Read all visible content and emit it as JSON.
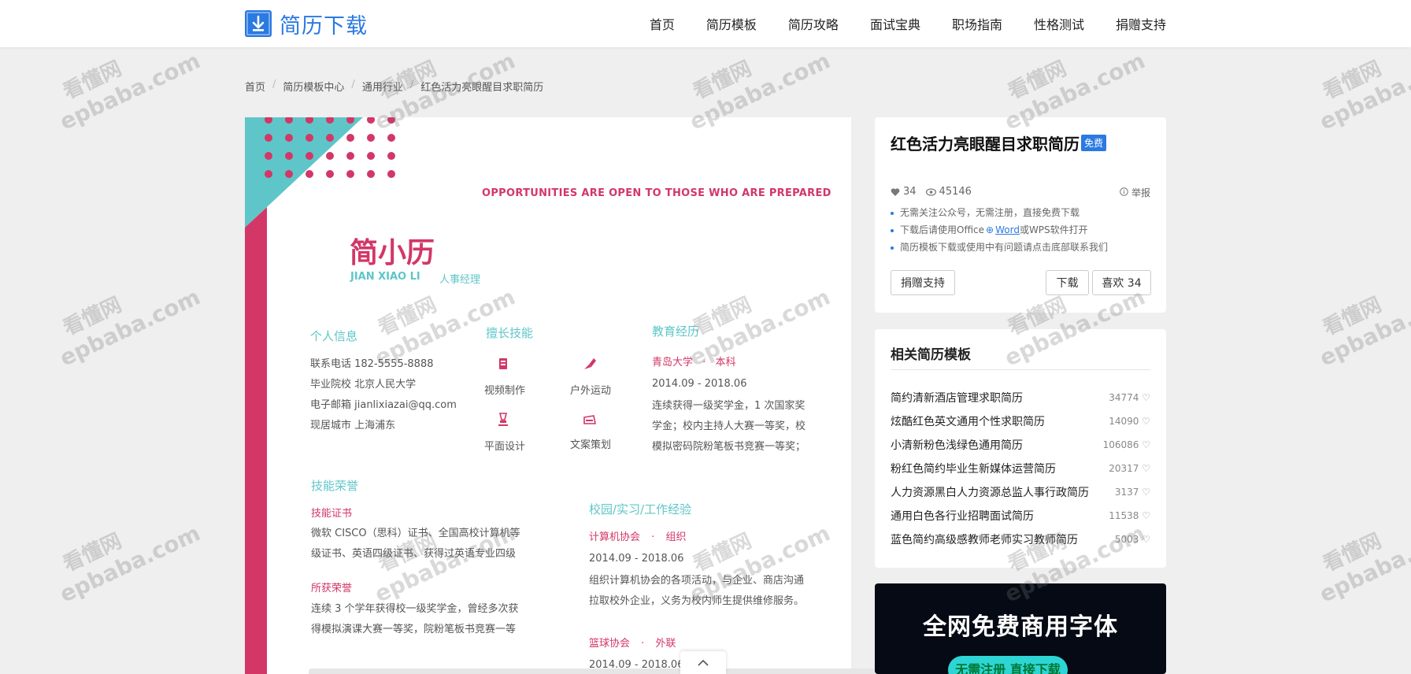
{
  "header": {
    "logo_text": "简历下载",
    "nav": [
      "首页",
      "简历模板",
      "简历攻略",
      "面试宝典",
      "职场指南",
      "性格测试",
      "捐赠支持"
    ]
  },
  "breadcrumb": [
    "首页",
    "简历模板中心",
    "通用行业",
    "红色活力亮眼醒目求职简历"
  ],
  "resume": {
    "slogan": "OPPORTUNITIES ARE OPEN TO THOSE WHO ARE PREPARED",
    "name": "简小历",
    "name_en": "JIAN XIAO LI",
    "position": "人事经理",
    "personal": {
      "title": "个人信息",
      "lines": [
        "联系电话  182-5555-8888",
        "毕业院校  北京人民大学",
        "电子邮箱  jianlixiazai@qq.com",
        "现居城市  上海浦东"
      ]
    },
    "skills": {
      "title": "擅长技能",
      "items": [
        {
          "label": "视频制作",
          "icon": "video-icon"
        },
        {
          "label": "户外运动",
          "icon": "sport-icon"
        },
        {
          "label": "平面设计",
          "icon": "design-icon"
        },
        {
          "label": "文案策划",
          "icon": "copywriting-icon"
        }
      ]
    },
    "education": {
      "title": "教育经历",
      "school": "青岛大学",
      "dot": "·",
      "degree": "本科",
      "period": "2014.09 - 2018.06",
      "lines": [
        "连续获得一级奖学金，1 次国家奖",
        "学金；校内主持人大赛一等奖，校",
        "模拟密码院粉笔板书竞赛一等奖；"
      ]
    },
    "honors": {
      "title": "技能荣誉",
      "cert_title": "技能证书",
      "cert_lines": [
        "微软 CISCO（思科）证书、全国高校计算机等",
        "级证书、英语四级证书、获得过英语专业四级"
      ],
      "award_title": "所获荣誉",
      "award_lines": [
        "连续 3 个学年获得校一级奖学金，曾经多次获",
        "得模拟演课大赛一等奖，院粉笔板书竞赛一等"
      ]
    },
    "experience": {
      "title": "校园/实习/工作经验",
      "org1": "计算机协会",
      "dot": "·",
      "role1": "组织",
      "period1": "2014.09 - 2018.06",
      "lines1": [
        "组织计算机协会的各项活动，与企业、商店沟通",
        "拉取校外企业，义务为校内师生提供维修服务。"
      ],
      "org2": "篮球协会",
      "role2": "外联",
      "period2": "2014.09 - 2018.06"
    }
  },
  "sidebar": {
    "title": "红色活力亮眼醒目求职简历",
    "badge": "免费",
    "likes": "34",
    "views": "45146",
    "report": "举报",
    "tips": [
      {
        "pre": "无需关注公众号，无需注册，直接免费下载",
        "link": "",
        "post": ""
      },
      {
        "pre": "下载后请使用Office",
        "link": "Word",
        "post": "或WPS软件打开"
      },
      {
        "pre": "简历模板下载或使用中有问题请点击底部联系我们",
        "link": "",
        "post": ""
      }
    ],
    "donate_btn": "捐赠支持",
    "download_btn": "下载",
    "like_btn": "喜欢 34"
  },
  "related": {
    "title": "相关简历模板",
    "items": [
      {
        "name": "简约清新酒店管理求职简历",
        "count": "34774"
      },
      {
        "name": "炫酷红色英文通用个性求职简历",
        "count": "14090"
      },
      {
        "name": "小清新粉色浅绿色通用简历",
        "count": "106086"
      },
      {
        "name": "粉红色简约毕业生新媒体运营简历",
        "count": "20317"
      },
      {
        "name": "人力资源黑白人力资源总监人事行政简历",
        "count": "3137"
      },
      {
        "name": "通用白色各行业招聘面试简历",
        "count": "11538"
      },
      {
        "name": "蓝色简约高级感教师老师实习教师简历",
        "count": "5003"
      }
    ]
  },
  "ad": {
    "headline": "全网免费商用字体",
    "button": "无需注册 直接下载"
  },
  "watermark": {
    "cn": "看懂网",
    "en": "epbaba.com"
  },
  "colors": {
    "brand": "#2a7ae2",
    "pink": "#d23767",
    "teal": "#5ec6c8"
  }
}
